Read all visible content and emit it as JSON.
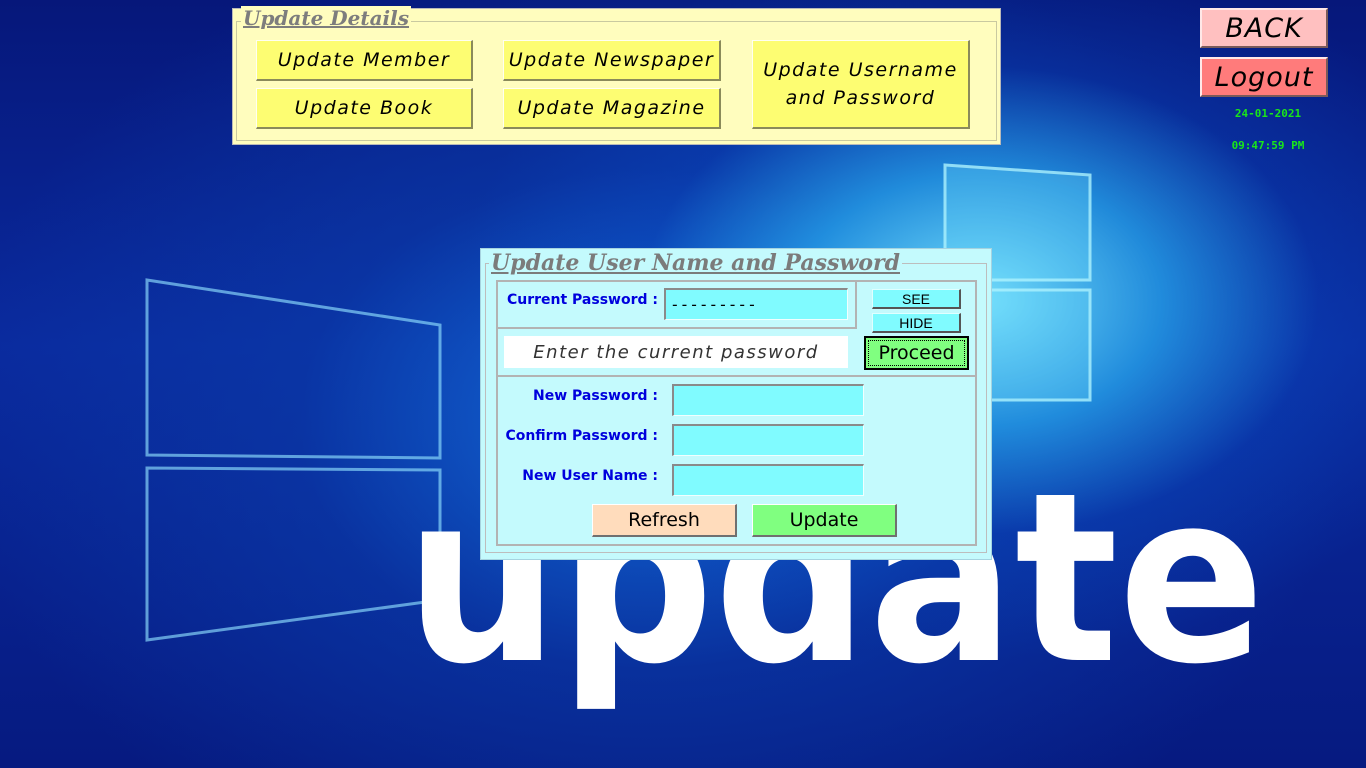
{
  "update_details": {
    "legend": "Update Details",
    "buttons": {
      "member": "Update Member",
      "book": "Update Book",
      "newspaper": "Update Newspaper",
      "magazine": "Update Magazine",
      "username_password_line1": "Update Username",
      "username_password_line2": "and Password"
    }
  },
  "top_right": {
    "back": "BACK",
    "logout": "Logout",
    "date": "24-01-2021",
    "time": "09:47:59 PM"
  },
  "dialog": {
    "legend": "Update User Name and Password",
    "current_password_label": "Current Password :",
    "current_password_value": "---------",
    "see_button": "SEE",
    "hide_button": "HIDE",
    "hint": "Enter the current password",
    "proceed_button": "Proceed",
    "new_password_label": "New Password :",
    "new_password_value": "",
    "confirm_password_label": "Confirm Password :",
    "confirm_password_value": "",
    "new_user_name_label": "New User Name :",
    "new_user_name_value": "",
    "refresh_button": "Refresh",
    "update_button": "Update"
  },
  "background": {
    "wallpaper_text": "update"
  },
  "colors": {
    "yellow_panel": "#fffdbe",
    "yellow_button": "#fdfd72",
    "cyan_panel": "#c4fafd",
    "cyan_field": "#80fbff",
    "label_blue": "#0000dd",
    "back_button": "#ffc0c0",
    "logout_button": "#ff7b7b",
    "clock_green": "#19e619",
    "proceed_green": "#80ff80",
    "refresh_peach": "#ffdcbc",
    "update_green": "#80ff80"
  }
}
